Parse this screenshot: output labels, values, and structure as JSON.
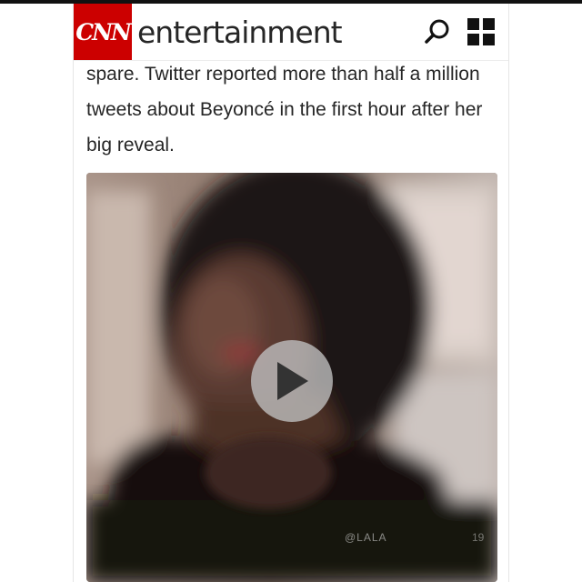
{
  "header": {
    "logo_text": "CNN",
    "section": "entertainment",
    "search_icon": "search-icon",
    "menu_icon": "grid-menu-icon",
    "brand_color": "#cc0000"
  },
  "article": {
    "text": "spare. Twitter reported more than half a million tweets about Beyoncé in the first hour after her big reveal."
  },
  "video": {
    "play_icon": "play-icon",
    "watermark": "@LALA",
    "watermark_2": "19"
  }
}
